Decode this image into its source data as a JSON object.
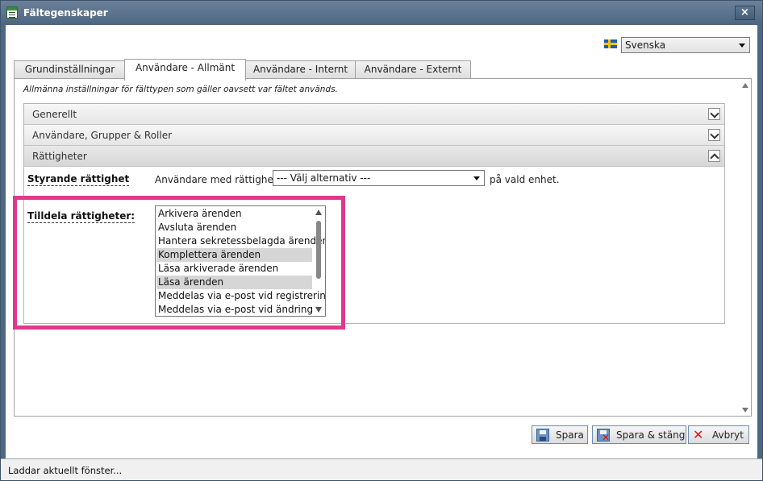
{
  "window": {
    "title": "Fältegenskaper",
    "close_label": "×"
  },
  "language": {
    "flag_icon": "sweden-flag-icon",
    "selected": "Svenska"
  },
  "tabs": [
    {
      "label": "Grundinställningar",
      "active": false
    },
    {
      "label": "Användare - Allmänt",
      "active": true
    },
    {
      "label": "Användare - Internt",
      "active": false
    },
    {
      "label": "Användare - Externt",
      "active": false
    }
  ],
  "panel": {
    "description": "Allmänna inställningar för fälttypen som gäller oavsett var fältet används.",
    "sections": [
      {
        "label": "Generellt",
        "expanded": false
      },
      {
        "label": "Användare, Grupper & Roller",
        "expanded": false
      },
      {
        "label": "Rättigheter",
        "expanded": true
      }
    ],
    "controlling_right": {
      "label": "Styrande rättighet",
      "prefix": "Användare med rättigheten",
      "select_value": "--- Välj alternativ ---",
      "suffix": "på vald enhet."
    },
    "assign_rights": {
      "label": "Tilldela rättigheter:",
      "items": [
        {
          "label": "Arkivera ärenden",
          "selected": false
        },
        {
          "label": "Avsluta ärenden",
          "selected": false
        },
        {
          "label": "Hantera sekretessbelagda ärenden",
          "selected": false
        },
        {
          "label": "Komplettera ärenden",
          "selected": true
        },
        {
          "label": "Läsa arkiverade ärenden",
          "selected": false
        },
        {
          "label": "Läsa ärenden",
          "selected": true
        },
        {
          "label": "Meddelas via e-post vid registrering",
          "selected": false
        },
        {
          "label": "Meddelas via e-post vid ändring",
          "selected": false
        }
      ]
    },
    "highlight_color": "#e0388c"
  },
  "buttons": {
    "save": "Spara",
    "save_close": "Spara & stäng",
    "cancel": "Avbryt"
  },
  "status": {
    "text": "Laddar aktuellt fönster..."
  }
}
